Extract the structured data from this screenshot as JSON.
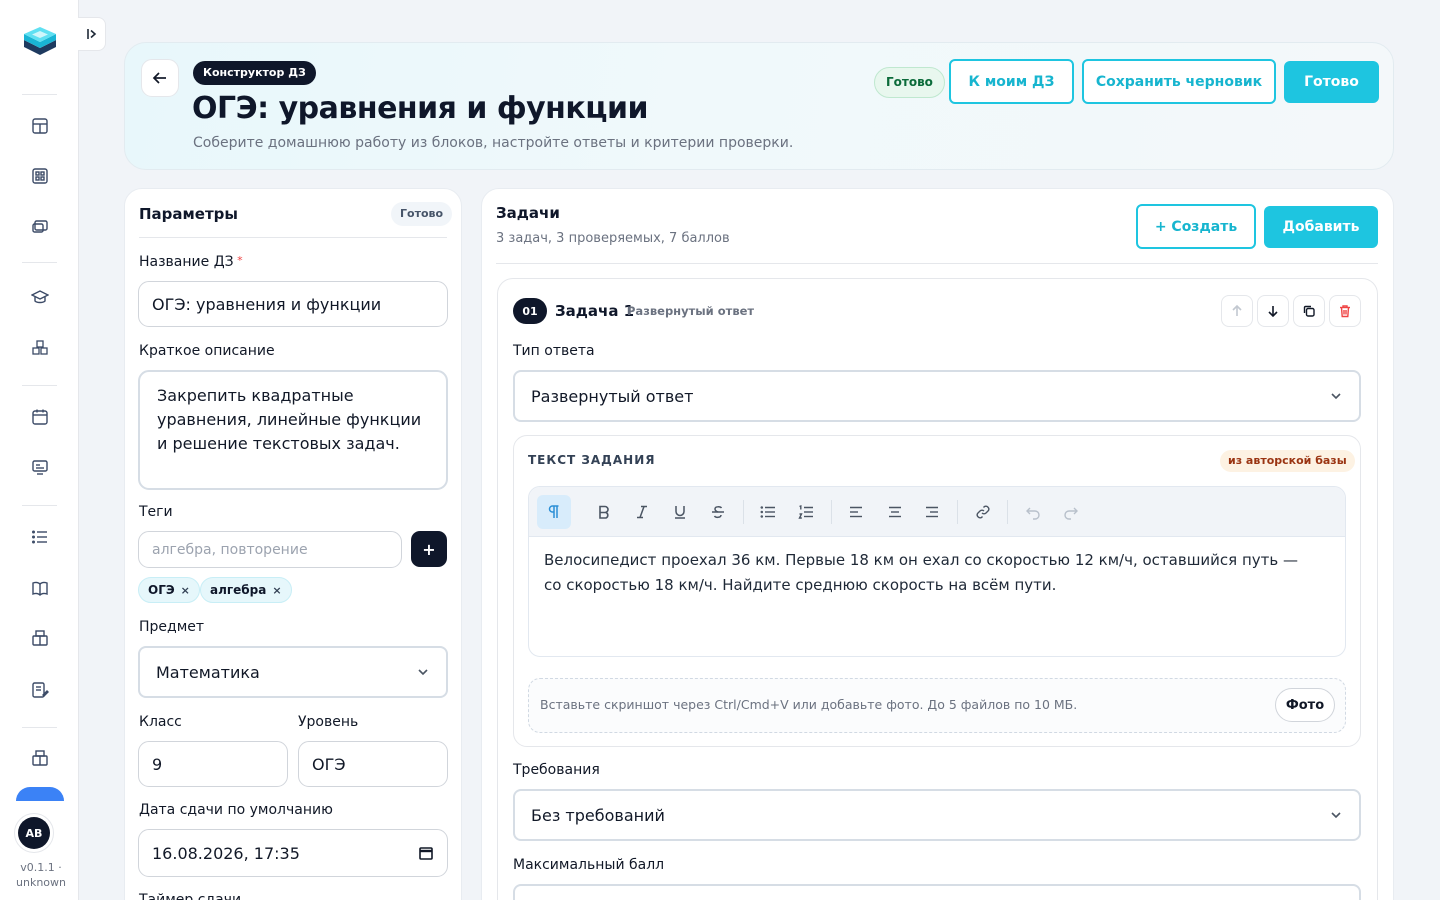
{
  "sidebar": {
    "icons": [
      "dashboard-icon",
      "grid-icon",
      "monitor-chat-icon",
      "graduation-cap-icon",
      "abc-blocks-icon",
      "calendar-icon",
      "screen-stats-icon",
      "list-icon",
      "book-icon",
      "package-icon",
      "edit-doc-icon",
      "package-alt-icon"
    ],
    "avatar_initials": "AB",
    "version": "v0.1.1 · unknown"
  },
  "header": {
    "breadcrumb": "Конструктор ДЗ",
    "title": "ОГЭ: уравнения и функции",
    "subtitle": "Соберите домашнюю работу из блоков, настройте ответы и критерии проверки.",
    "status": "Готово",
    "btn_my_hw": "К моим ДЗ",
    "btn_save_draft": "Сохранить черновик",
    "btn_done": "Готово"
  },
  "params": {
    "title": "Параметры",
    "status": "Готово",
    "name_label": "Название ДЗ",
    "name_value": "ОГЭ: уравнения и функции",
    "desc_label": "Краткое описание",
    "desc_value": "Закрепить квадратные уравнения, линейные функции и решение текстовых задач.",
    "tags_label": "Теги",
    "tags_placeholder": "алгебра, повторение",
    "tags_add": "+",
    "tags": [
      "ОГЭ",
      "алгебра"
    ],
    "tag_remove": "×",
    "subject_label": "Предмет",
    "subject_value": "Математика",
    "class_label": "Класс",
    "class_value": "9",
    "level_label": "Уровень",
    "level_value": "ОГЭ",
    "due_label": "Дата сдачи по умолчанию",
    "due_value": "16.08.2026, 17:35",
    "next_label": "Таймер сдачи"
  },
  "tasks": {
    "title": "Задачи",
    "summary": "3 задач, 3 проверяемых, 7 баллов",
    "btn_create": "+ Создать",
    "btn_add": "Добавить",
    "task1": {
      "number": "01",
      "title": "Задача 1",
      "type_hint": "Развернутый ответ",
      "answer_type_label": "Тип ответа",
      "answer_type_value": "Развернутый ответ",
      "text_section_label": "ТЕКСТ ЗАДАНИЯ",
      "source_badge": "из авторской базы",
      "text": "Велосипедист проехал 36 км. Первые 18 км он ехал со скоростью 12 км/ч, оставшийся путь — со скоростью 18 км/ч. Найдите среднюю скорость на всём пути.",
      "drop_hint": "Вставьте скриншот через Ctrl/Cmd+V или добавьте фото. До 5 файлов по 10 МБ.",
      "photo_btn": "Фото",
      "requirements_label": "Требования",
      "requirements_value": "Без требований",
      "max_score_label": "Максимальный балл"
    }
  },
  "colors": {
    "accent": "#1ec5e0",
    "dark": "#0f172a"
  }
}
